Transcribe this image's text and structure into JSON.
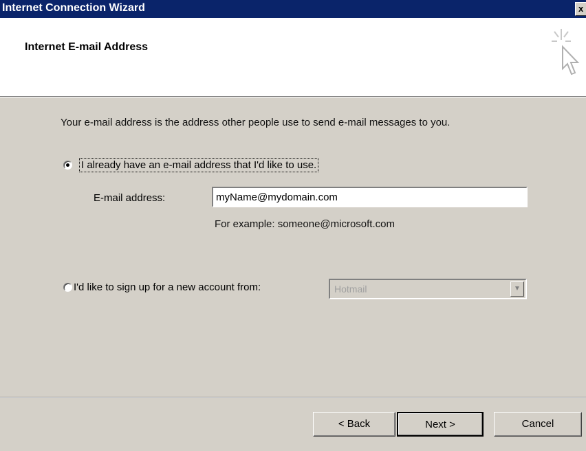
{
  "window": {
    "title": "Internet Connection Wizard",
    "close_glyph": "x"
  },
  "header": {
    "title": "Internet E-mail Address",
    "icon": "wizard-cursor-sparkle-icon"
  },
  "intro_text": "Your e-mail address is the address other people use to send e-mail messages to you.",
  "option_existing": {
    "label": "I already have an e-mail address that I'd like to use.",
    "selected": true,
    "email_label": "E-mail address:",
    "email_value": "myName@mydomain.com",
    "example": "For example: someone@microsoft.com"
  },
  "option_new": {
    "label": "I'd like to sign up for a new account from:",
    "selected": false,
    "provider_value": "Hotmail",
    "enabled": false
  },
  "buttons": {
    "back": "< Back",
    "next": "Next >",
    "cancel": "Cancel"
  }
}
